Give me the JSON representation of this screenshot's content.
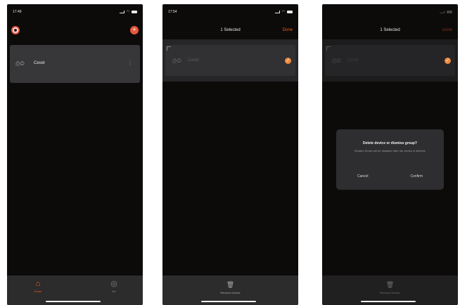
{
  "screen1": {
    "status_time": "17:49",
    "device": {
      "name": "Cevet"
    },
    "tabs": [
      {
        "label": "Home"
      },
      {
        "label": "Me"
      }
    ]
  },
  "screen2": {
    "status_time": "17:54",
    "header_title": "1 Selected",
    "header_done": "Done",
    "device": {
      "name": "Cevet"
    },
    "remove_label": "Remove Device"
  },
  "screen3": {
    "header_title": "1 Selected",
    "header_done": "Done",
    "device": {
      "name": "Cevet"
    },
    "dialog": {
      "title": "Delete device or dismiss group?",
      "message": "Related Smart will be disabled after the device is deleted.",
      "cancel": "Cancel",
      "confirm": "Confirm"
    },
    "remove_label": "Remove Device"
  },
  "colors": {
    "accent": "#ee5a24",
    "background": "#0d0a0a",
    "card": "#37373a"
  },
  "icons": [
    "app-logo",
    "add-icon",
    "camera-icon",
    "more-icon",
    "checkmark-icon",
    "home-icon",
    "profile-icon",
    "trash-icon"
  ]
}
